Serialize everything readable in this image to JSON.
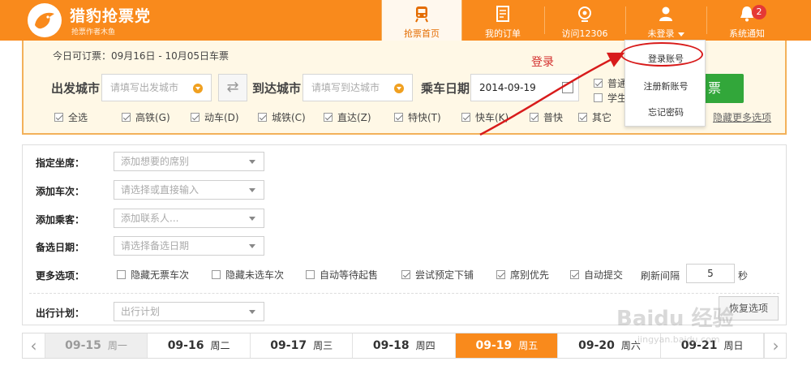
{
  "header": {
    "brand": "猎豹抢票党",
    "brand_sub": "抢票作者木鱼",
    "nav": [
      {
        "label": "抢票首页",
        "icon": "train-icon"
      },
      {
        "label": "我的订单",
        "icon": "order-icon"
      },
      {
        "label": "访问12306",
        "icon": "globe-icon"
      },
      {
        "label": "未登录",
        "icon": "user-icon"
      },
      {
        "label": "系统通知",
        "icon": "bell-icon"
      }
    ],
    "notify_count": "2"
  },
  "search": {
    "today": "今日可订票：09月16日 - 10月05日车票",
    "from_label": "出发城市",
    "from_placeholder": "请填写出发城市",
    "to_label": "到达城市",
    "to_placeholder": "请填写到达城市",
    "date_label": "乘车日期",
    "date_value": "2014-09-19",
    "ticket_type_1": "普通",
    "ticket_type_2": "学生",
    "query_button": "票",
    "train_types": [
      {
        "label": "全选",
        "checked": true
      },
      {
        "label": "高铁(G)",
        "checked": true
      },
      {
        "label": "动车(D)",
        "checked": true
      },
      {
        "label": "城铁(C)",
        "checked": true
      },
      {
        "label": "直达(Z)",
        "checked": true
      },
      {
        "label": "特快(T)",
        "checked": true
      },
      {
        "label": "快车(K)",
        "checked": true
      },
      {
        "label": "普快",
        "checked": true
      },
      {
        "label": "其它",
        "checked": true
      }
    ],
    "hide_more": "隐藏更多选项"
  },
  "dropdown": {
    "items": [
      "登录账号",
      "注册新账号",
      "忘记密码"
    ]
  },
  "annotation": "登录",
  "options": {
    "seat_label": "指定坐席：",
    "seat_placeholder": "添加想要的席别",
    "train_label": "添加车次：",
    "train_placeholder": "请选择或直接输入",
    "passenger_label": "添加乘客：",
    "passenger_placeholder": "添加联系人...",
    "backup_date_label": "备选日期：",
    "backup_date_placeholder": "请选择备选日期",
    "more_label": "更多选项：",
    "more_items": [
      {
        "label": "隐藏无票车次",
        "checked": false
      },
      {
        "label": "隐藏未选车次",
        "checked": false
      },
      {
        "label": "自动等待起售",
        "checked": false
      },
      {
        "label": "尝试预定下铺",
        "checked": true
      },
      {
        "label": "席别优先",
        "checked": true
      },
      {
        "label": "自动提交",
        "checked": true
      }
    ],
    "refresh_label": "刷新间隔",
    "refresh_value": "5",
    "refresh_unit": "秒",
    "plan_label": "出行计划：",
    "plan_placeholder": "出行计划",
    "restore_button": "恢复选项"
  },
  "dates": [
    {
      "date": "09-15",
      "weekday": "周一",
      "state": "past"
    },
    {
      "date": "09-16",
      "weekday": "周二",
      "state": "normal"
    },
    {
      "date": "09-17",
      "weekday": "周三",
      "state": "normal"
    },
    {
      "date": "09-18",
      "weekday": "周四",
      "state": "normal"
    },
    {
      "date": "09-19",
      "weekday": "周五",
      "state": "selected"
    },
    {
      "date": "09-20",
      "weekday": "周六",
      "state": "normal"
    },
    {
      "date": "09-21",
      "weekday": "周日",
      "state": "normal"
    }
  ],
  "date_nav": {
    "prev": "‹",
    "next": "›"
  },
  "watermark": {
    "text": "Baidu 经验",
    "url": "jingyan.baidu.com"
  },
  "colors": {
    "accent": "#f98a1c",
    "go": "#32a73a",
    "alert": "#d81b1b"
  }
}
